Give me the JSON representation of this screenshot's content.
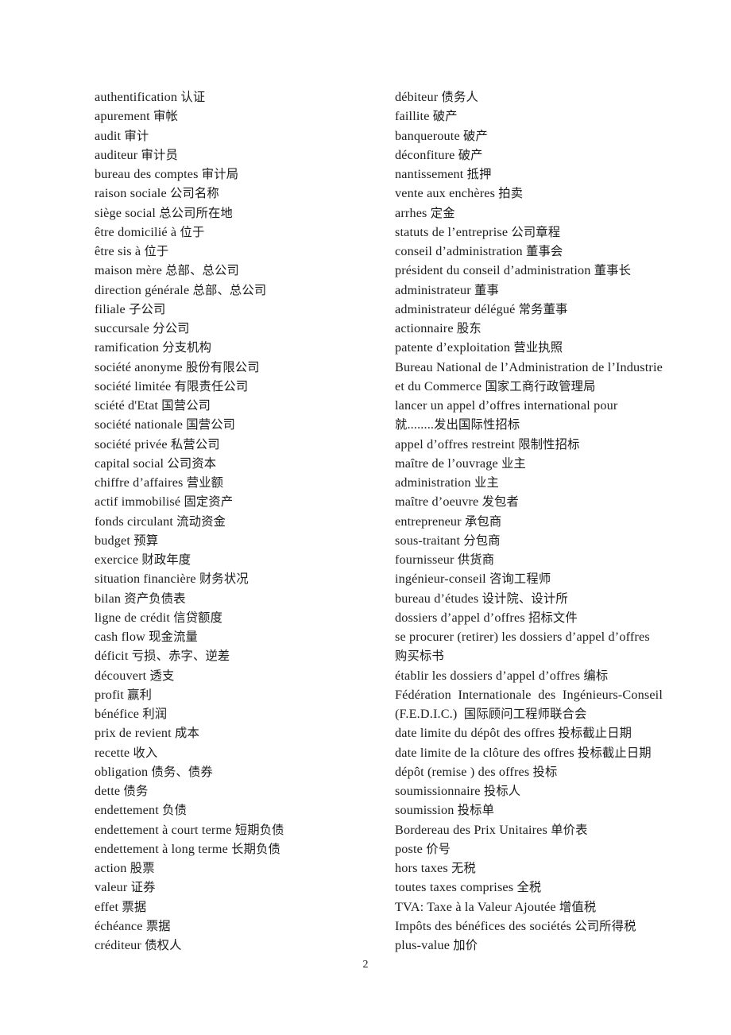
{
  "document": {
    "page_number": "2",
    "columns": {
      "left": [
        "authentification 认证",
        "apurement 审帐",
        "audit 审计",
        "auditeur 审计员",
        "bureau des comptes 审计局",
        "raison sociale 公司名称",
        "siège social 总公司所在地",
        "être domicilié à 位于",
        "être sis à 位于",
        "maison mère 总部、总公司",
        "direction générale 总部、总公司",
        "filiale 子公司",
        "succursale 分公司",
        "ramification 分支机构",
        "société anonyme 股份有限公司",
        "société limitée 有限责任公司",
        "sciété d'Etat 国营公司",
        "société nationale 国营公司",
        "société privée 私营公司",
        "capital social 公司资本",
        "chiffre d’affaires 营业额",
        "actif immobilisé 固定资产",
        "fonds circulant 流动资金",
        "budget 预算",
        "exercice 财政年度",
        "situation financière 财务状况",
        "bilan 资产负债表",
        "ligne de crédit 信贷额度",
        "cash flow 现金流量",
        "déficit 亏损、赤字、逆差",
        "découvert 透支",
        "profit 赢利",
        "bénéfice 利润",
        "prix de revient 成本",
        "recette 收入",
        "obligation 债务、债券",
        "dette 债务",
        "endettement 负债",
        "endettement à court terme 短期负债",
        "endettement à long terme 长期负债",
        "action 股票",
        "valeur 证券",
        "effet 票据",
        "échéance 票据",
        "créditeur 债权人"
      ],
      "right": [
        "débiteur 债务人",
        "faillite 破产",
        "banqueroute 破产",
        "déconfiture 破产",
        "nantissement 抵押",
        "vente aux enchères 拍卖",
        "arrhes 定金",
        "statuts de l’entreprise 公司章程",
        "conseil d’administration 董事会",
        "président du conseil d’administration 董事长",
        "administrateur 董事",
        "administrateur délégué 常务董事",
        "actionnaire 股东",
        "patente d’exploitation 营业执照",
        "Bureau National de l’Administration de l’Industrie",
        "et du Commerce 国家工商行政管理局",
        "lancer un appel d’offres international pour",
        "就........发出国际性招标",
        "appel d’offres restreint 限制性招标",
        "maître de l’ouvrage 业主",
        "administration 业主",
        "maître d’oeuvre 发包者",
        "entrepreneur 承包商",
        "sous-traitant 分包商",
        "fournisseur 供货商",
        "ingénieur-conseil 咨询工程师",
        "bureau d’études 设计院、设计所",
        "dossiers d’appel d’offres 招标文件",
        "se procurer (retirer) les dossiers d’appel d’offres",
        "购买标书",
        "établir les dossiers d’appel d’offres 编标",
        "Fédération Internationale des Ingénieurs-Conseil",
        "(F.E.D.I.C.)  国际顾问工程师联合会",
        "date limite du dépôt des offres 投标截止日期",
        "date limite de la clôture des offres 投标截止日期",
        "dépôt (remise ) des offres 投标",
        "soumissionnaire 投标人",
        "soumission 投标单",
        "Bordereau des Prix Unitaires 单价表",
        "poste 价号",
        "hors taxes 无税",
        "toutes taxes comprises 全税",
        "TVA: Taxe à la Valeur Ajoutée 增值税",
        "Impôts des bénéfices des sociétés 公司所得税",
        "plus-value 加价"
      ]
    },
    "justified_line_indices": {
      "right": [
        14,
        31
      ]
    }
  }
}
